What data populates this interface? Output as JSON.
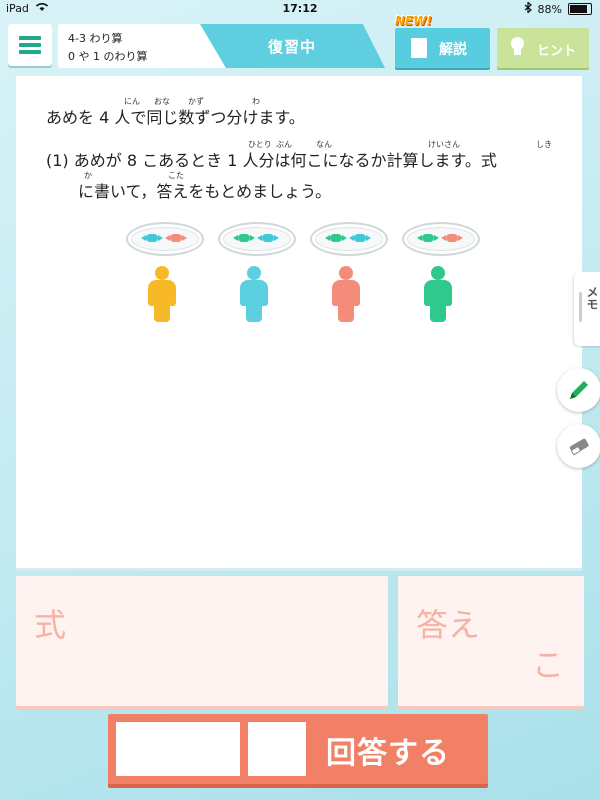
{
  "status_bar": {
    "device": "iPad",
    "time": "17:12",
    "battery": "88%"
  },
  "header": {
    "lesson_line1": "4-3 わり算",
    "lesson_line2": "0 や 1 のわり算",
    "status": "復習中",
    "new_badge": "NEW!",
    "explanation_label": "解説",
    "hint_label": "ヒント"
  },
  "question": {
    "line1": "あめを 4 人で同じ数ずつ分けます。",
    "line2": "(1) あめが 8 こあるとき 1 人分は何こになるか計算します。式",
    "line3": "に書いて，答えをもとめましょう。",
    "ruby": [
      "にん",
      "おな",
      "かず",
      "わ",
      "ひとり",
      "ぶん",
      "なん",
      "けいさん",
      "しき",
      "か",
      "こた"
    ]
  },
  "illustration": {
    "people_colors": [
      "#f7b928",
      "#5ccfe0",
      "#f48c7c",
      "#2fc98d"
    ],
    "candy_pairs": [
      [
        "#3ec8d8",
        "#f48c7c"
      ],
      [
        "#2fc98d",
        "#3ec8d8"
      ],
      [
        "#2fc98d",
        "#3ec8d8"
      ],
      [
        "#2fc98d",
        "#f48c7c"
      ]
    ]
  },
  "side_tools": {
    "memo_label": "メモ"
  },
  "answer": {
    "shiki_label": "式",
    "kotae_label": "答え",
    "unit": "こ"
  },
  "submit": {
    "label": "回答する"
  }
}
